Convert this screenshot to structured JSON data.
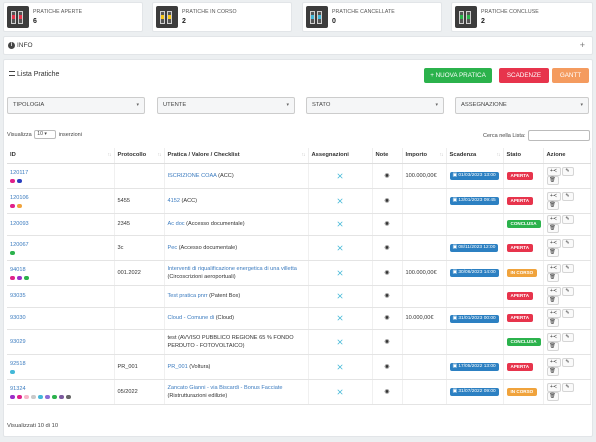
{
  "stats": [
    {
      "label": "PRATICHE APERTE",
      "value": "6",
      "accent": "#e7344c"
    },
    {
      "label": "PRATICHE IN CORSO",
      "value": "2",
      "accent": "#f5c518"
    },
    {
      "label": "PRATICHE CANCELLATE",
      "value": "0",
      "accent": "#43b8d8"
    },
    {
      "label": "PRATICHE CONCLUSE",
      "value": "2",
      "accent": "#2bb24c"
    }
  ],
  "info": {
    "icon": "info-icon",
    "title": "INFO",
    "expand": "+"
  },
  "main": {
    "title": "Lista Pratiche",
    "buttons": {
      "new": "+ NUOVA PRATICA",
      "scadenze": "SCADENZE",
      "gantt": "GANTT"
    },
    "filters": [
      "TIPOLOGIA",
      "UTENTE",
      "STATO",
      "ASSEGNAZIONE"
    ],
    "show_prefix": "Visualizza",
    "show_value": "10",
    "show_suffix": "inserzioni",
    "search_label": "Cerca nella Lista:",
    "footer": "Visualizzati 10 di 10"
  },
  "columns": [
    "ID",
    "Protocollo",
    "Pratica / Valore / Checklist",
    "Assegnazioni",
    "Note",
    "Importo",
    "Scadenza",
    "Stato",
    "Azione"
  ],
  "status_colors": {
    "APERTA": "#e7344c",
    "CONCLUSA": "#2bb24c",
    "IN CORSO": "#f0a33c"
  },
  "rows": [
    {
      "id": "120117",
      "protocollo": "",
      "pratica": "ISCRIZIONE COAA",
      "sub": " (ACC)",
      "sub2": "",
      "importo": "100.000,00€",
      "scadenza": "01/03/2023 13:00",
      "stato": "APERTA",
      "dots": [
        "#e0218a",
        "#2a3fbf"
      ]
    },
    {
      "id": "120106",
      "protocollo": "5455",
      "pratica": "4152",
      "sub": " (ACC)",
      "sub2": "",
      "importo": "",
      "scadenza": "13/01/2023 09:45",
      "stato": "APERTA",
      "dots": [
        "#e0218a",
        "#f0a33c"
      ]
    },
    {
      "id": "120093",
      "protocollo": "2345",
      "pratica": "Ac doc",
      "sub": " (Accesso documentale)",
      "sub2": "",
      "importo": "",
      "scadenza": "",
      "stato": "CONCLUSA",
      "dots": []
    },
    {
      "id": "120067",
      "protocollo": "3c",
      "pratica": "Pec",
      "sub": " (Accesso documentale)",
      "sub2": "",
      "importo": "",
      "scadenza": "08/11/2023 12:00",
      "stato": "APERTA",
      "dots": [
        "#2bb24c"
      ]
    },
    {
      "id": "94018",
      "protocollo": "001.2022",
      "pratica": "Interventi di riqualificazione energetica di una villetta",
      "sub": "",
      "sub2": "(Circoscrizioni aeroportuali)",
      "importo": "100.000,00€",
      "scadenza": "30/06/2023 14:00",
      "stato": "IN CORSO",
      "dots": [
        "#e0218a",
        "#9b2fc9",
        "#2bb24c"
      ]
    },
    {
      "id": "93035",
      "protocollo": "",
      "pratica": "Test pratica pnrr",
      "sub": " (Patent Box)",
      "sub2": "",
      "importo": "",
      "scadenza": "",
      "stato": "APERTA",
      "dots": []
    },
    {
      "id": "93030",
      "protocollo": "",
      "pratica": "Cloud - Comune di",
      "sub": " (Cloud)",
      "sub2": "",
      "importo": "10.000,00€",
      "scadenza": "31/01/2023 00:00",
      "stato": "APERTA",
      "dots": []
    },
    {
      "id": "93029",
      "protocollo": "",
      "pratica": "",
      "sub": "test (AVVISO PUBBLICO REGIONE 65 % FONDO",
      "sub2": "PERDUTO - FOTOVOLTAICO)",
      "importo": "",
      "scadenza": "",
      "stato": "CONCLUSA",
      "dots": []
    },
    {
      "id": "92518",
      "protocollo": "PR_001",
      "pratica": "PR_001",
      "sub": " (Voltura)",
      "sub2": "",
      "importo": "",
      "scadenza": "17/05/2022 13:00",
      "stato": "APERTA",
      "dots": [
        "#43b8d8"
      ]
    },
    {
      "id": "91324",
      "protocollo": "05/2022",
      "pratica": "Zancato Gianni - via Biscardi - Bonus Facciate",
      "sub": "",
      "sub2": "(Ristrutturazioni edilizie)",
      "importo": "",
      "scadenza": "31/07/2022 09:00",
      "stato": "IN CORSO",
      "dots": [
        "#9b2fc9",
        "#e0218a",
        "#f6b6c8",
        "#c9c9c9",
        "#43b8d8",
        "#8a6cd6",
        "#2bb24c",
        "#7c5a9e",
        "#666666"
      ]
    }
  ],
  "actions": {
    "assign": "+≺",
    "edit": "✎",
    "delete": "🗑"
  }
}
